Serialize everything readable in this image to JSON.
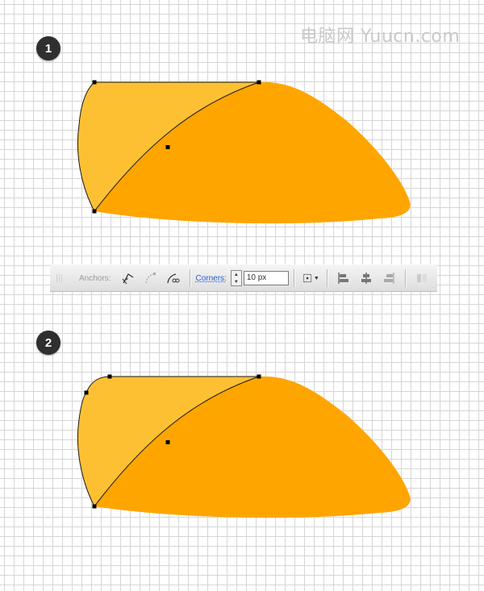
{
  "watermark": {
    "text": "电脑网 Yuucn.com"
  },
  "steps": [
    {
      "number": "1"
    },
    {
      "number": "2"
    }
  ],
  "toolbar": {
    "anchors_label": "Anchors:",
    "corners_label": "Corners:",
    "corners_value": "10 px",
    "icons": [
      "convert-anchor-corner-icon",
      "convert-anchor-smooth-icon",
      "cut-path-icon",
      "transform-reference-icon",
      "align-left-icon",
      "align-center-icon",
      "align-right-icon",
      "distribute-icon"
    ]
  },
  "colors": {
    "light_orange": "#FEC033",
    "dark_orange": "#FEA500",
    "grid": "#D6D6D6",
    "badge": "#2F2F2F",
    "toolbar_link": "#2A5FD0"
  }
}
